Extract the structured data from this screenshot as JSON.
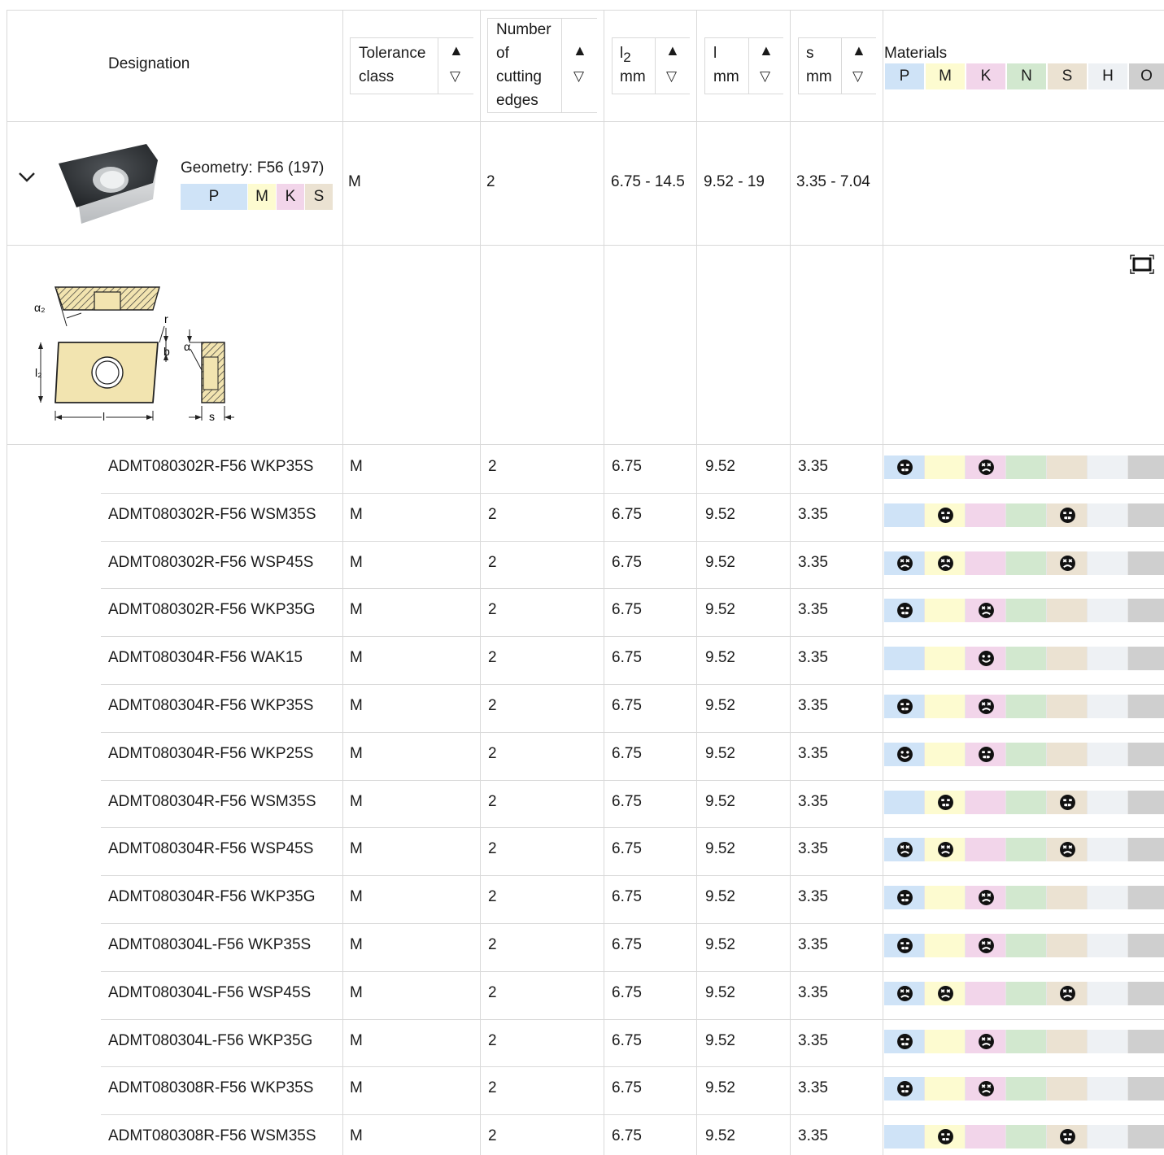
{
  "header": {
    "designation": "Designation",
    "tolerance_line1": "Tolerance",
    "tolerance_line2": "class",
    "edges_line1": "Number",
    "edges_line2": "of",
    "edges_line3": "cutting",
    "edges_line4": "edges",
    "l2_sym": "l",
    "l2_sub": "2",
    "l2_unit": "mm",
    "l_sym": "l",
    "l_unit": "mm",
    "s_sym": "s",
    "s_unit": "mm",
    "materials": "Materials",
    "sort_up": "▲",
    "sort_down": "▽",
    "material_groups": [
      "P",
      "M",
      "K",
      "N",
      "S",
      "H",
      "O"
    ]
  },
  "colors": {
    "P": "#cfe3f7",
    "M": "#fdfbd0",
    "K": "#f2d5ea",
    "N": "#d2e8cf",
    "S": "#ebe2d2",
    "H": "#eef1f4",
    "O": "#cfcfcf"
  },
  "geometry": {
    "label": "Geometry: F56 (197)",
    "materials": [
      "P",
      "M",
      "K",
      "S"
    ],
    "tolerance": "M",
    "edges": "2",
    "l2": "6.75 - 14.5",
    "l": "9.52 - 19",
    "s": "3.35 - 7.04",
    "diagram_labels": {
      "a2": "α₂",
      "r": "r",
      "b": "b",
      "a": "α",
      "l2": "l₂",
      "l": "l",
      "s": "s"
    }
  },
  "icons": {
    "chevron": "chevron-down-icon",
    "fullscreen": "fullscreen-icon",
    "grade_primary": "smiley-good-icon",
    "grade_good": "smiley-ok-icon",
    "grade_possible": "smiley-cross-icon"
  },
  "rows": [
    {
      "designation": "ADMT080302R-F56 WKP35S",
      "tolerance": "M",
      "edges": "2",
      "l2": "6.75",
      "l": "9.52",
      "s": "3.35",
      "grades": {
        "P": "ok",
        "K": "cross"
      }
    },
    {
      "designation": "ADMT080302R-F56 WSM35S",
      "tolerance": "M",
      "edges": "2",
      "l2": "6.75",
      "l": "9.52",
      "s": "3.35",
      "grades": {
        "M": "ok",
        "S": "ok"
      }
    },
    {
      "designation": "ADMT080302R-F56 WSP45S",
      "tolerance": "M",
      "edges": "2",
      "l2": "6.75",
      "l": "9.52",
      "s": "3.35",
      "grades": {
        "P": "cross",
        "M": "cross",
        "S": "cross"
      }
    },
    {
      "designation": "ADMT080302R-F56 WKP35G",
      "tolerance": "M",
      "edges": "2",
      "l2": "6.75",
      "l": "9.52",
      "s": "3.35",
      "grades": {
        "P": "ok",
        "K": "cross"
      }
    },
    {
      "designation": "ADMT080304R-F56 WAK15",
      "tolerance": "M",
      "edges": "2",
      "l2": "6.75",
      "l": "9.52",
      "s": "3.35",
      "grades": {
        "K": "good"
      }
    },
    {
      "designation": "ADMT080304R-F56 WKP35S",
      "tolerance": "M",
      "edges": "2",
      "l2": "6.75",
      "l": "9.52",
      "s": "3.35",
      "grades": {
        "P": "ok",
        "K": "cross"
      }
    },
    {
      "designation": "ADMT080304R-F56 WKP25S",
      "tolerance": "M",
      "edges": "2",
      "l2": "6.75",
      "l": "9.52",
      "s": "3.35",
      "grades": {
        "P": "good",
        "K": "ok"
      }
    },
    {
      "designation": "ADMT080304R-F56 WSM35S",
      "tolerance": "M",
      "edges": "2",
      "l2": "6.75",
      "l": "9.52",
      "s": "3.35",
      "grades": {
        "M": "ok",
        "S": "ok"
      }
    },
    {
      "designation": "ADMT080304R-F56 WSP45S",
      "tolerance": "M",
      "edges": "2",
      "l2": "6.75",
      "l": "9.52",
      "s": "3.35",
      "grades": {
        "P": "cross",
        "M": "cross",
        "S": "cross"
      }
    },
    {
      "designation": "ADMT080304R-F56 WKP35G",
      "tolerance": "M",
      "edges": "2",
      "l2": "6.75",
      "l": "9.52",
      "s": "3.35",
      "grades": {
        "P": "ok",
        "K": "cross"
      }
    },
    {
      "designation": "ADMT080304L-F56 WKP35S",
      "tolerance": "M",
      "edges": "2",
      "l2": "6.75",
      "l": "9.52",
      "s": "3.35",
      "grades": {
        "P": "ok",
        "K": "cross"
      }
    },
    {
      "designation": "ADMT080304L-F56 WSP45S",
      "tolerance": "M",
      "edges": "2",
      "l2": "6.75",
      "l": "9.52",
      "s": "3.35",
      "grades": {
        "P": "cross",
        "M": "cross",
        "S": "cross"
      }
    },
    {
      "designation": "ADMT080304L-F56 WKP35G",
      "tolerance": "M",
      "edges": "2",
      "l2": "6.75",
      "l": "9.52",
      "s": "3.35",
      "grades": {
        "P": "ok",
        "K": "cross"
      }
    },
    {
      "designation": "ADMT080308R-F56 WKP35S",
      "tolerance": "M",
      "edges": "2",
      "l2": "6.75",
      "l": "9.52",
      "s": "3.35",
      "grades": {
        "P": "ok",
        "K": "cross"
      }
    },
    {
      "designation": "ADMT080308R-F56 WSM35S",
      "tolerance": "M",
      "edges": "2",
      "l2": "6.75",
      "l": "9.52",
      "s": "3.35",
      "grades": {
        "M": "ok",
        "S": "ok"
      }
    }
  ]
}
